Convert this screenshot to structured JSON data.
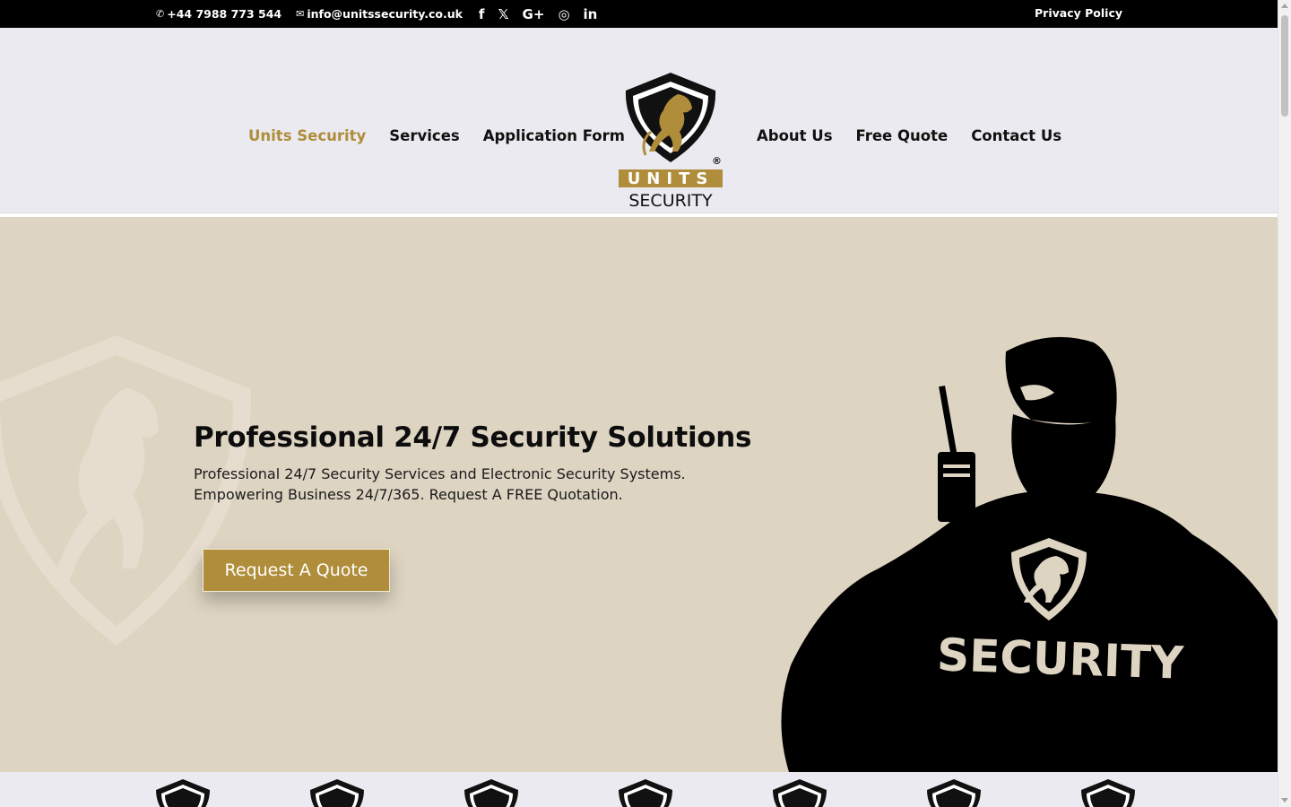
{
  "topbar": {
    "phone": "+44 7988 773 544",
    "email": "info@unitssecurity.co.uk",
    "socials": [
      {
        "name": "facebook",
        "glyph": "f"
      },
      {
        "name": "x",
        "glyph": "𝕏"
      },
      {
        "name": "google-plus",
        "glyph": "G+"
      },
      {
        "name": "instagram",
        "glyph": "◎"
      },
      {
        "name": "linkedin",
        "glyph": "in"
      }
    ],
    "privacy_label": "Privacy Policy"
  },
  "nav": {
    "left": [
      "Units Security",
      "Services",
      "Application Form"
    ],
    "right": [
      "About Us",
      "Free Quote",
      "Contact Us"
    ],
    "active": "Units Security"
  },
  "logo": {
    "word1": "UNITS",
    "word2": "SECURITY",
    "registered": "®"
  },
  "hero": {
    "title": "Professional 24/7 Security Solutions",
    "subtitle": "Professional 24/7 Security Services and Electronic Security Systems. Empowering Business 24/7/365. Request A FREE Quotation.",
    "cta_label": "Request A Quote",
    "jacket_text": "SECURITY"
  },
  "colors": {
    "accent": "#b08d3a",
    "topbar": "#000000",
    "header_bg": "#eaeaf0",
    "hero_bg": "#ded4c2"
  }
}
